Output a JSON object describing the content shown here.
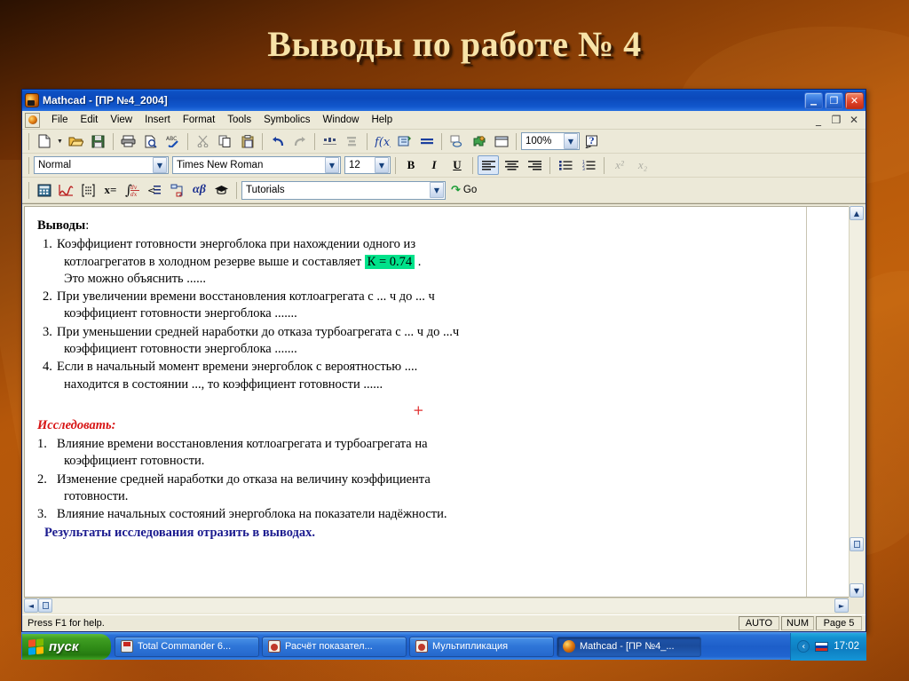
{
  "slide": {
    "title": "Выводы по работе № 4"
  },
  "window": {
    "title": "Mathcad  -  [ПР №4_2004]",
    "app_icon": "mathcad-icon",
    "controls": {
      "minimize": "_",
      "restore": "❐",
      "close": "✕"
    },
    "doc_controls": {
      "minimize": "_",
      "restore": "❐",
      "close": "✕"
    }
  },
  "menu": {
    "items": [
      {
        "label": "File"
      },
      {
        "label": "Edit"
      },
      {
        "label": "View"
      },
      {
        "label": "Insert"
      },
      {
        "label": "Format"
      },
      {
        "label": "Tools"
      },
      {
        "label": "Symbolics"
      },
      {
        "label": "Window"
      },
      {
        "label": "Help"
      }
    ]
  },
  "standard_toolbar": {
    "buttons": [
      {
        "name": "new-document-icon",
        "tip": "New"
      },
      {
        "name": "new-dropdown-arrow",
        "tip": "New dropdown"
      },
      {
        "name": "open-folder-icon",
        "tip": "Open"
      },
      {
        "name": "save-floppy-icon",
        "tip": "Save"
      },
      {
        "name": "print-icon",
        "tip": "Print"
      },
      {
        "name": "print-preview-icon",
        "tip": "Print Preview"
      },
      {
        "name": "spell-check-icon",
        "tip": "Check Spelling"
      },
      {
        "name": "cut-scissors-icon",
        "tip": "Cut"
      },
      {
        "name": "copy-icon",
        "tip": "Copy"
      },
      {
        "name": "paste-clipboard-icon",
        "tip": "Paste"
      },
      {
        "name": "undo-icon",
        "tip": "Undo"
      },
      {
        "name": "redo-icon",
        "tip": "Redo"
      },
      {
        "name": "align-across-icon",
        "tip": "Align Across"
      },
      {
        "name": "align-down-icon",
        "tip": "Align Down"
      },
      {
        "name": "insert-function-icon",
        "tip": "Insert Function"
      },
      {
        "name": "insert-unit-icon",
        "tip": "Insert Unit"
      },
      {
        "name": "calculate-equals-icon",
        "tip": "Calculate"
      },
      {
        "name": "insert-hyperlink-icon",
        "tip": "Insert Hyperlink"
      },
      {
        "name": "component-wizard-icon",
        "tip": "Component"
      },
      {
        "name": "insert-area-icon",
        "tip": "Insert Area"
      }
    ],
    "zoom_value": "100%",
    "help_icon": "help-question-icon"
  },
  "format_toolbar": {
    "style_value": "Normal",
    "font_value": "Times New Roman",
    "size_value": "12",
    "bold": "B",
    "italic": "I",
    "underline": "U",
    "align_left_icon": "align-left-icon",
    "align_center_icon": "align-center-icon",
    "align_right_icon": "align-right-icon",
    "bullet_list_icon": "bullet-list-icon",
    "numbered_list_icon": "numbered-list-icon",
    "superscript": "x²",
    "subscript": "x₂"
  },
  "math_toolbar": {
    "buttons": [
      {
        "name": "calculator-toolbar-icon"
      },
      {
        "name": "graph-toolbar-icon"
      },
      {
        "name": "matrix-toolbar-icon"
      },
      {
        "name": "evaluation-toolbar-icon",
        "label": "x="
      },
      {
        "name": "calculus-toolbar-icon"
      },
      {
        "name": "boolean-toolbar-icon"
      },
      {
        "name": "programming-toolbar-icon"
      },
      {
        "name": "greek-toolbar-icon",
        "label": "αβ"
      },
      {
        "name": "symbolic-toolbar-icon"
      }
    ],
    "resource_value": "Tutorials",
    "go_label": "Go"
  },
  "document": {
    "heading": "Выводы",
    "heading_colon": ":",
    "conclusions": [
      {
        "num": "1.",
        "lines": [
          {
            "text": "Коэффициент готовности энергоблока  при нахождении одного из",
            "indent": false
          },
          {
            "text": "котлоагрегатов в холодном резерве выше и составляет ",
            "indent": true,
            "highlight": "К = 0.74",
            "after": " ."
          },
          {
            "text": "Это можно объяснить ......",
            "indent": true
          }
        ]
      },
      {
        "num": "2.",
        "lines": [
          {
            "text": "При увеличении времени восстановления  котлоагрегата с ... ч до ... ч",
            "indent": false
          },
          {
            "text": "коэффициент готовности  энергоблока .......",
            "indent": true
          }
        ]
      },
      {
        "num": "3.",
        "lines": [
          {
            "text": "При уменьшении средней наработки до отказа  турбоагрегата с ... ч до ...ч",
            "indent": false
          },
          {
            "text": "коэффициент готовности  энергоблока .......",
            "indent": true
          }
        ]
      },
      {
        "num": "4.",
        "lines": [
          {
            "text": "Если в начальный момент времени  энергоблок с вероятностью ....",
            "indent": false
          },
          {
            "text": "находится в состоянии ..., то  коэффициент готовности ......",
            "indent": true
          }
        ]
      }
    ],
    "cursor_crosshair": "+",
    "investigate_heading": "Исследовать:",
    "investigations": [
      {
        "num": "1.",
        "lines": [
          {
            "text": "Влияние времени восстановления котлоагрегата и турбоагрегата  на",
            "indent": false
          },
          {
            "text": "коэффициент готовности.",
            "indent": true
          }
        ]
      },
      {
        "num": "2.",
        "lines": [
          {
            "text": "Изменение средней наработки до отказа на величину коэффициента",
            "indent": false
          },
          {
            "text": "готовности.",
            "indent": true
          }
        ]
      },
      {
        "num": "3.",
        "lines": [
          {
            "text": "Влияние начальных состояний энергоблока на показатели надёжности.",
            "indent": false
          }
        ]
      }
    ],
    "final_note": "Результаты исследования отразить в выводах."
  },
  "statusbar": {
    "message": "Press F1 for help.",
    "auto": "AUTO",
    "num": "NUM",
    "page": "Page 5"
  },
  "taskbar": {
    "start_label": "пуск",
    "tasks": [
      {
        "label": "Total Commander 6...",
        "icon": "total-commander-icon",
        "active": false
      },
      {
        "label": "Расчёт показател...",
        "icon": "powerpoint-icon",
        "active": false
      },
      {
        "label": "Мультипликация",
        "icon": "powerpoint-icon",
        "active": false
      },
      {
        "label": "Mathcad - [ПР №4_...",
        "icon": "mathcad-icon",
        "active": true
      }
    ],
    "tray": {
      "chevron": "‹",
      "language_flag": "russian-flag-icon",
      "clock": "17:02"
    }
  },
  "colors": {
    "desktop_orange": "#b5570a",
    "title_gold": "#f7e3a8",
    "highlight_green": "#00e28a",
    "investigate_red": "#d71414",
    "final_blue": "#1b1b8f",
    "titlebar_blue": "#0b49bb"
  }
}
